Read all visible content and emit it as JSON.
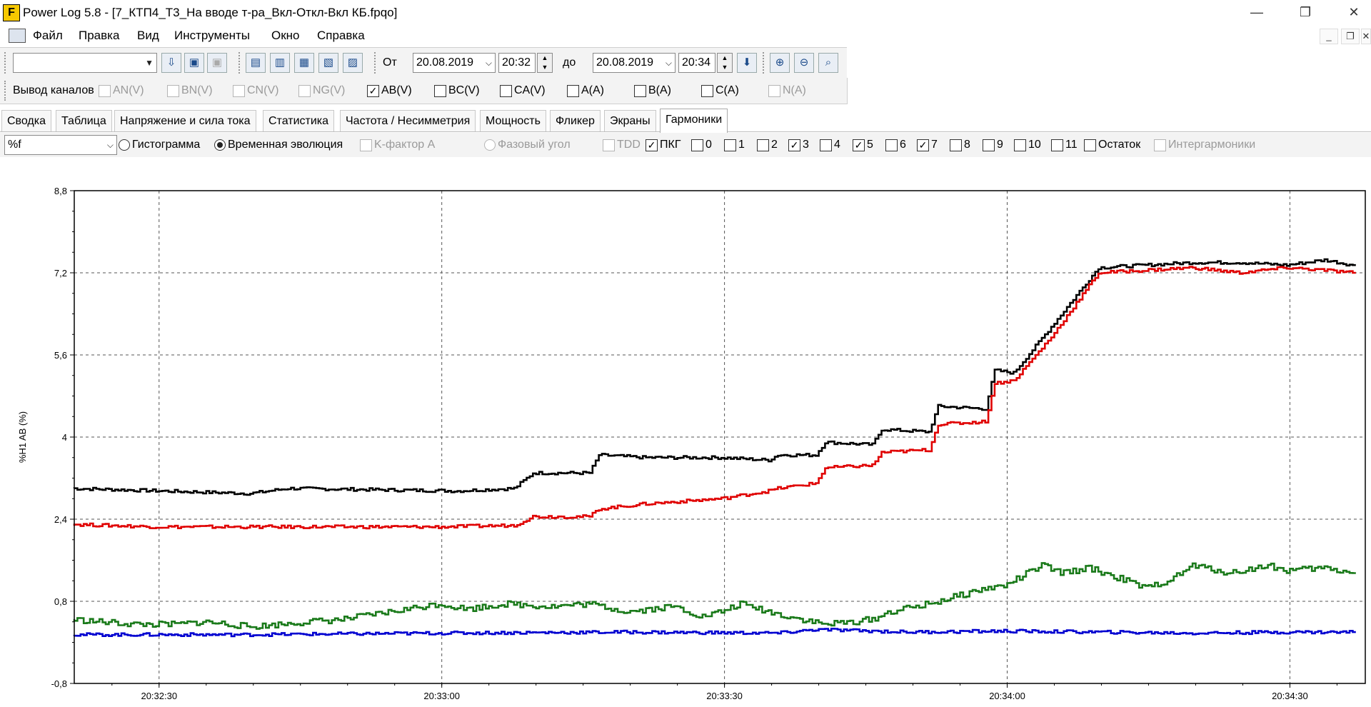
{
  "window": {
    "title": "Power Log 5.8 - [7_КТП4_Т3_На вводе т-ра_Вкл-Откл-Вкл КБ.fpqo]",
    "app_icon_letter": "F",
    "minimize": "—",
    "restore": "❐",
    "close": "✕"
  },
  "menu": {
    "items": [
      "Файл",
      "Правка",
      "Вид",
      "Инструменты",
      "Окно",
      "Справка"
    ],
    "mdi_minimize": "_",
    "mdi_restore": "❐",
    "mdi_close": "✕"
  },
  "toolbar": {
    "from_label": "От",
    "from_date": "20.08.2019",
    "from_time": "20:32",
    "to_label": "до",
    "to_date": "20.08.2019",
    "to_time": "20:34"
  },
  "channels": {
    "label": "Вывод каналов",
    "items": [
      {
        "label": "AN(V)",
        "checked": false,
        "enabled": false
      },
      {
        "label": "BN(V)",
        "checked": false,
        "enabled": false
      },
      {
        "label": "CN(V)",
        "checked": false,
        "enabled": false
      },
      {
        "label": "NG(V)",
        "checked": false,
        "enabled": false
      },
      {
        "label": "AB(V)",
        "checked": true,
        "enabled": true
      },
      {
        "label": "BC(V)",
        "checked": false,
        "enabled": true
      },
      {
        "label": "CA(V)",
        "checked": false,
        "enabled": true
      },
      {
        "label": "A(A)",
        "checked": false,
        "enabled": true
      },
      {
        "label": "B(A)",
        "checked": false,
        "enabled": true
      },
      {
        "label": "C(A)",
        "checked": false,
        "enabled": true
      },
      {
        "label": "N(A)",
        "checked": false,
        "enabled": false
      }
    ]
  },
  "tabs": [
    "Сводка",
    "Таблица",
    "Напряжение и сила тока",
    "Статистика",
    "Частота / Несимметрия",
    "Мощность",
    "Фликер",
    "Экраны",
    "Гармоники"
  ],
  "active_tab": "Гармоники",
  "options": {
    "unit_select": "%f",
    "histogram": "Гистограмма",
    "time_evolution": "Временная эволюция",
    "k_factor": "K-фактор A",
    "phase_angle": "Фазовый угол",
    "tdd": "TDD",
    "harmonics": [
      {
        "label": "ПКГ",
        "checked": true
      },
      {
        "label": "0",
        "checked": false
      },
      {
        "label": "1",
        "checked": false
      },
      {
        "label": "2",
        "checked": false
      },
      {
        "label": "3",
        "checked": true
      },
      {
        "label": "4",
        "checked": false
      },
      {
        "label": "5",
        "checked": true
      },
      {
        "label": "6",
        "checked": false
      },
      {
        "label": "7",
        "checked": true
      },
      {
        "label": "8",
        "checked": false
      },
      {
        "label": "9",
        "checked": false
      },
      {
        "label": "10",
        "checked": false
      },
      {
        "label": "11",
        "checked": false
      },
      {
        "label": "Остаток",
        "checked": false
      }
    ],
    "interharmonics": "Интергармоники"
  },
  "chart_data": {
    "type": "line",
    "ylabel": "%H1 AB (%)",
    "xlabel": "",
    "ylim": [
      -0.8,
      8.8
    ],
    "yticks": [
      "-0,8",
      "0,8",
      "2,4",
      "4",
      "5,6",
      "7,2",
      "8,8"
    ],
    "ytick_values": [
      -0.8,
      0.8,
      2.4,
      4.0,
      5.6,
      7.2,
      8.8
    ],
    "xlim_seconds": [
      21,
      158
    ],
    "xticks": [
      "20:32:30",
      "20:33:00",
      "20:33:30",
      "20:34:00",
      "20:34:30"
    ],
    "xtick_seconds": [
      30,
      60,
      90,
      120,
      150
    ],
    "grid": true,
    "series": [
      {
        "color": "#000000",
        "x": [
          21,
          40,
          44,
          62,
          68,
          70,
          76,
          77,
          82,
          90,
          95,
          96,
          100,
          101,
          106,
          107,
          112,
          113,
          118,
          119,
          121,
          125,
          130,
          135,
          140,
          145,
          150,
          154,
          157
        ],
        "values": [
          3.0,
          2.9,
          3.0,
          2.95,
          3.0,
          3.3,
          3.3,
          3.65,
          3.6,
          3.6,
          3.55,
          3.65,
          3.65,
          3.9,
          3.85,
          4.15,
          4.1,
          4.6,
          4.55,
          5.3,
          5.25,
          6.15,
          7.3,
          7.35,
          7.4,
          7.4,
          7.35,
          7.45,
          7.35
        ]
      },
      {
        "color": "#e00000",
        "x": [
          21,
          30,
          40,
          60,
          68,
          70,
          76,
          77,
          82,
          90,
          95,
          96,
          100,
          101,
          106,
          107,
          112,
          113,
          118,
          119,
          121,
          125,
          130,
          135,
          140,
          145,
          150,
          154,
          157
        ],
        "values": [
          2.3,
          2.25,
          2.25,
          2.25,
          2.28,
          2.45,
          2.45,
          2.6,
          2.7,
          2.8,
          2.95,
          3.0,
          3.1,
          3.4,
          3.45,
          3.7,
          3.75,
          4.25,
          4.3,
          5.05,
          5.1,
          5.95,
          7.2,
          7.25,
          7.3,
          7.2,
          7.3,
          7.25,
          7.2
        ]
      },
      {
        "color": "#1a7a1a",
        "x": [
          21,
          24,
          28,
          32,
          35,
          38,
          40,
          43,
          46,
          50,
          55,
          60,
          63,
          67,
          72,
          76,
          80,
          85,
          88,
          90,
          92,
          96,
          101,
          104,
          106,
          108,
          112,
          115,
          118,
          120,
          124,
          126,
          129,
          133,
          135,
          138,
          140,
          144,
          148,
          150,
          154,
          157
        ],
        "values": [
          0.45,
          0.4,
          0.35,
          0.35,
          0.4,
          0.35,
          0.3,
          0.35,
          0.4,
          0.45,
          0.6,
          0.75,
          0.65,
          0.75,
          0.7,
          0.75,
          0.6,
          0.7,
          0.5,
          0.6,
          0.75,
          0.55,
          0.35,
          0.4,
          0.45,
          0.6,
          0.75,
          0.9,
          1.05,
          1.1,
          1.5,
          1.35,
          1.45,
          1.2,
          1.05,
          1.25,
          1.5,
          1.35,
          1.5,
          1.4,
          1.45,
          1.35
        ]
      },
      {
        "color": "#0000d0",
        "x": [
          21,
          40,
          60,
          80,
          96,
          100,
          110,
          120,
          130,
          140,
          150,
          157
        ],
        "values": [
          0.15,
          0.15,
          0.18,
          0.2,
          0.18,
          0.25,
          0.2,
          0.22,
          0.2,
          0.18,
          0.2,
          0.2
        ]
      }
    ]
  }
}
